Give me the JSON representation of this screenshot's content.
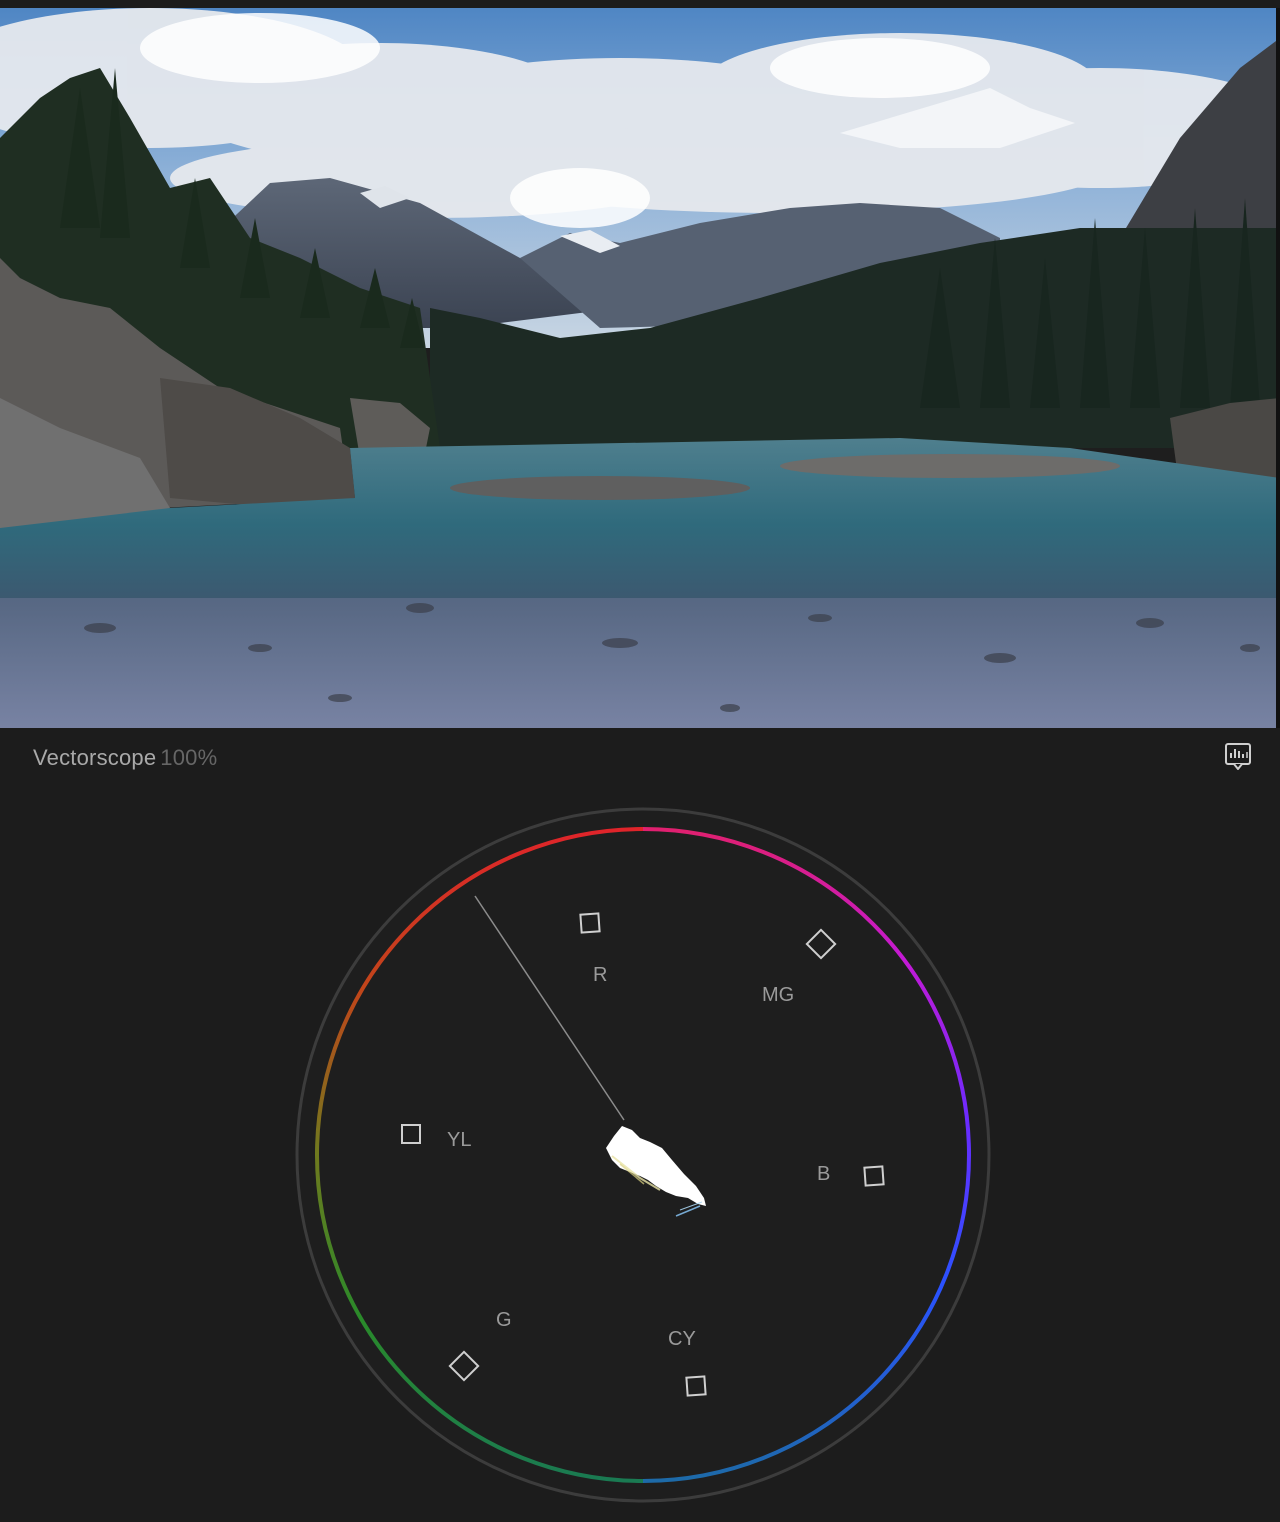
{
  "viewer": {
    "frame_description_icon": "landscape-frame"
  },
  "scope": {
    "title": "Vectorscope",
    "zoom": "100%",
    "settings_icon": "scope-settings-icon",
    "targets": [
      {
        "id": "r",
        "label": "R"
      },
      {
        "id": "mg",
        "label": "MG"
      },
      {
        "id": "b",
        "label": "B"
      },
      {
        "id": "cy",
        "label": "CY"
      },
      {
        "id": "g",
        "label": "G"
      },
      {
        "id": "yl",
        "label": "YL"
      }
    ],
    "colors": {
      "background": "#1c1c1c",
      "graticule": "#3a3a3a",
      "trace": "#ffffff",
      "label": "#9a9a9a"
    }
  }
}
